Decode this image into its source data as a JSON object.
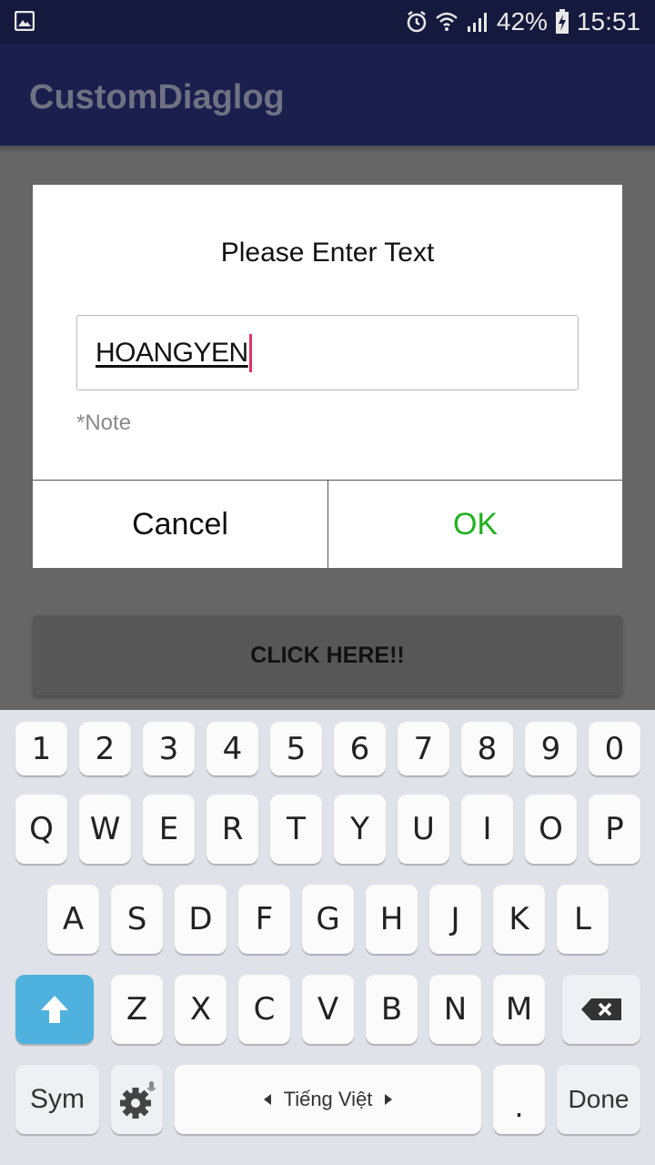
{
  "status_bar": {
    "battery": "42%",
    "time": "15:51",
    "icons": [
      "gallery-icon",
      "alarm-icon",
      "wifi-icon",
      "signal-icon",
      "battery-charging-icon"
    ]
  },
  "app_bar": {
    "title": "CustomDiaglog"
  },
  "main": {
    "button_label": "CLICK HERE!!"
  },
  "dialog": {
    "title": "Please Enter Text",
    "input_value": "HOANGYEN",
    "note": "*Note",
    "cancel_label": "Cancel",
    "ok_label": "OK",
    "ok_color": "#22b022"
  },
  "keyboard": {
    "row_numbers": [
      "1",
      "2",
      "3",
      "4",
      "5",
      "6",
      "7",
      "8",
      "9",
      "0"
    ],
    "row_1": [
      "Q",
      "W",
      "E",
      "R",
      "T",
      "Y",
      "U",
      "I",
      "O",
      "P"
    ],
    "row_2": [
      "A",
      "S",
      "D",
      "F",
      "G",
      "H",
      "J",
      "K",
      "L"
    ],
    "row_3": [
      "Z",
      "X",
      "C",
      "V",
      "B",
      "N",
      "M"
    ],
    "sym_label": "Sym",
    "space_label": "Tiếng Việt",
    "period_label": ".",
    "done_label": "Done",
    "shift_color": "#4fb1dd"
  }
}
